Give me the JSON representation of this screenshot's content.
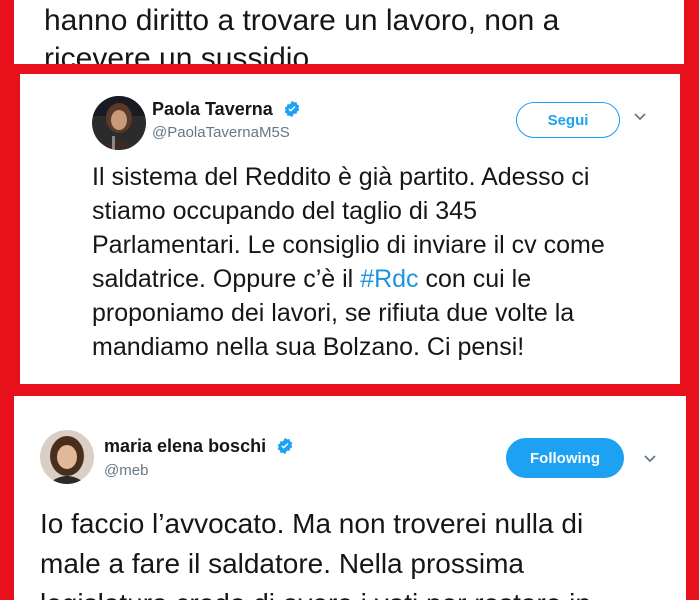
{
  "top_tweet": {
    "lines": [
      "hanno diritto a trovare un lavoro, non a",
      "ricevere un sussidio"
    ]
  },
  "tweet_paola": {
    "name": "Paola Taverna",
    "handle": "@PaolaTavernaM5S",
    "follow_label": "Segui",
    "body_lines": [
      "Il sistema del Reddito è già partito. Adesso ci",
      "stiamo occupando del taglio di 345",
      "Parlamentari. Le consiglio di inviare il cv come",
      "saldatrice. Oppure c’è il ",
      "#Rdc",
      " con cui le",
      "proponiamo dei lavori, se rifiuta due volte la",
      "mandiamo nella sua Bolzano. Ci pensi!"
    ]
  },
  "tweet_boschi": {
    "name": "maria elena boschi",
    "handle": "@meb",
    "follow_label": "Following",
    "body_lines": [
      "Io faccio l’avvocato. Ma non troverei nulla di",
      "male a fare il saldatore. Nella prossima",
      "legislatura credo di avere i voti per restare in"
    ]
  },
  "colors": {
    "border_red": "#e8101a",
    "twitter_blue": "#1da1f2",
    "hashtag_blue": "#1b95e0",
    "handle_gray": "#657786"
  },
  "icons": {
    "verified": "verified-badge-icon",
    "chevron": "chevron-down-icon"
  }
}
